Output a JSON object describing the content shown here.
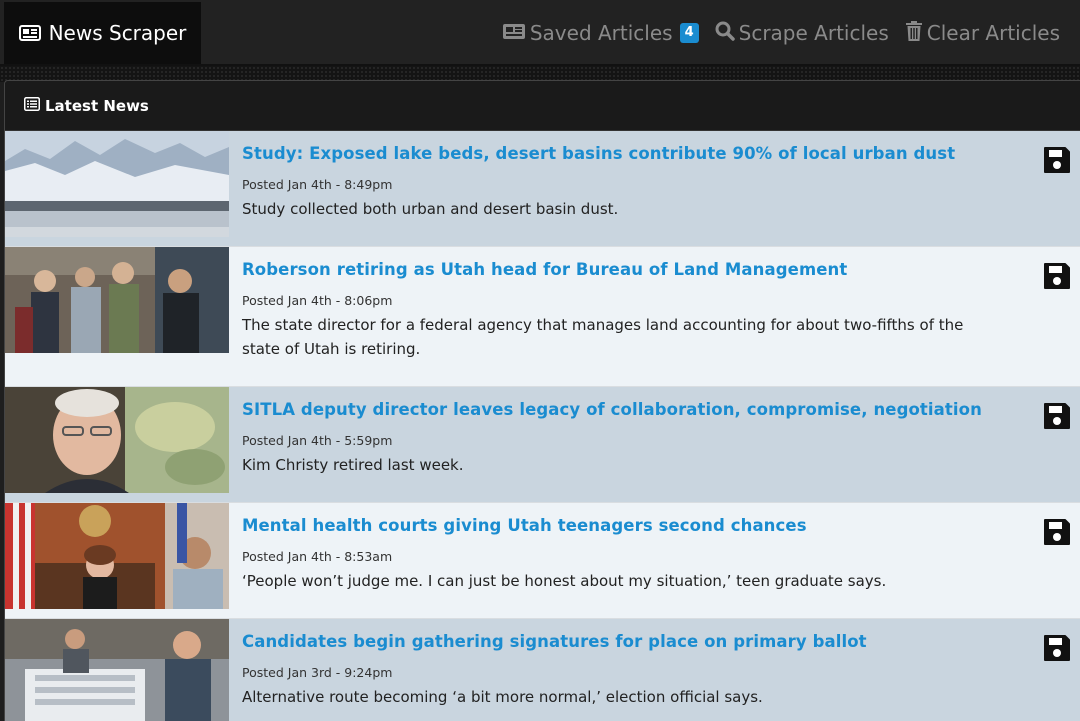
{
  "brand": {
    "label": "News Scraper",
    "icon": "newspaper-icon"
  },
  "nav": {
    "saved_label": "Saved Articles",
    "saved_count": "4",
    "scrape_label": "Scrape Articles",
    "clear_label": "Clear Articles"
  },
  "panel": {
    "title": "Latest News"
  },
  "colors": {
    "accent": "#1a8cd0",
    "row_odd": "#c9d5df",
    "row_even": "#eef3f7"
  },
  "articles": [
    {
      "title": "Study: Exposed lake beds, desert basins contribute 90% of local urban dust",
      "posted": "Posted Jan 4th - 8:49pm",
      "summary": "Study collected both urban and desert basin dust."
    },
    {
      "title": "Roberson retiring as Utah head for Bureau of Land Management",
      "posted": "Posted Jan 4th - 8:06pm",
      "summary": "The state director for a federal agency that manages land accounting for about two-fifths of the state of Utah is retiring."
    },
    {
      "title": "SITLA deputy director leaves legacy of collaboration, compromise, negotiation",
      "posted": "Posted Jan 4th - 5:59pm",
      "summary": "Kim Christy retired last week."
    },
    {
      "title": "Mental health courts giving Utah teenagers second chances",
      "posted": "Posted Jan 4th - 8:53am",
      "summary": "‘People won’t judge me. I can just be honest about my situation,’ teen graduate says."
    },
    {
      "title": "Candidates begin gathering signatures for place on primary ballot",
      "posted": "Posted Jan 3rd - 9:24pm",
      "summary": "Alternative route becoming ‘a bit more normal,’ election official says."
    }
  ]
}
